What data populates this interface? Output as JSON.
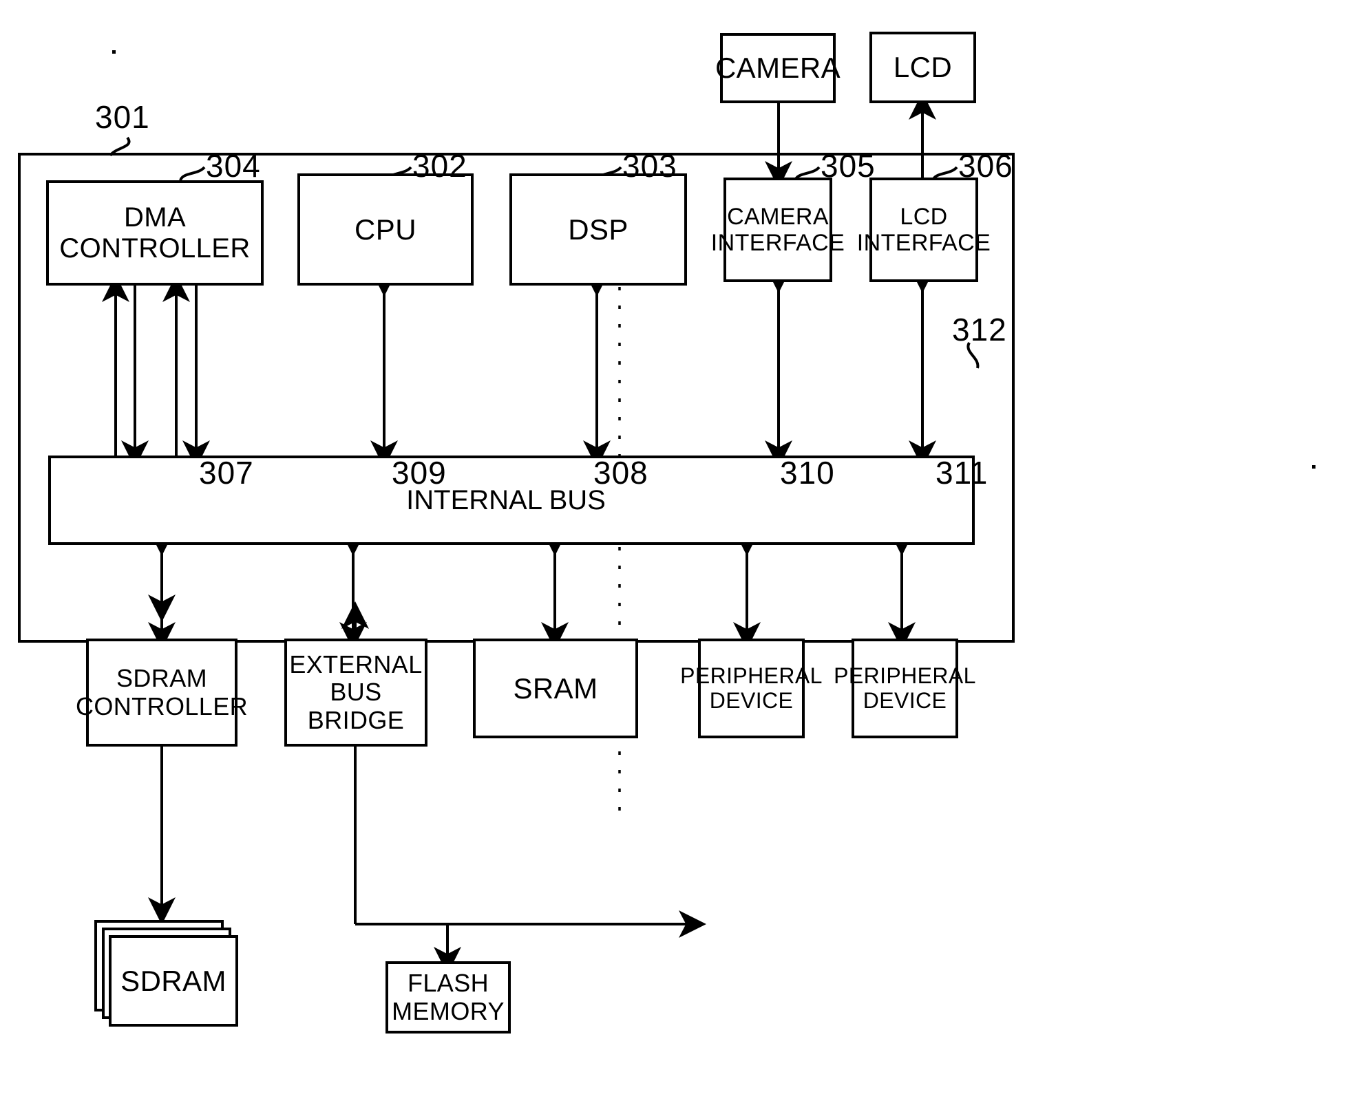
{
  "figure": {
    "type": "block-diagram",
    "title": "System LSI block diagram",
    "chip_label": "301"
  },
  "external_blocks": [
    {
      "id": "camera",
      "label": "CAMERA",
      "ref": ""
    },
    {
      "id": "lcd",
      "label": "LCD",
      "ref": ""
    },
    {
      "id": "sdram",
      "label": "SDRAM",
      "ref": ""
    },
    {
      "id": "flash_memory",
      "label": "FLASH\nMEMORY",
      "ref": ""
    }
  ],
  "internal_blocks": [
    {
      "id": "dma_controller",
      "label": "DMA CONTROLLER",
      "ref": "304"
    },
    {
      "id": "cpu",
      "label": "CPU",
      "ref": "302"
    },
    {
      "id": "dsp",
      "label": "DSP",
      "ref": "303"
    },
    {
      "id": "camera_interface",
      "label": "CAMERA\nINTERFACE",
      "ref": "305"
    },
    {
      "id": "lcd_interface",
      "label": "LCD\nINTERFACE",
      "ref": "306"
    },
    {
      "id": "internal_bus",
      "label": "INTERNAL BUS",
      "ref": "312"
    },
    {
      "id": "sdram_controller",
      "label": "SDRAM\nCONTROLLER",
      "ref": "307"
    },
    {
      "id": "external_bus_bridge",
      "label": "EXTERNAL\nBUS BRIDGE",
      "ref": "309"
    },
    {
      "id": "sram",
      "label": "SRAM",
      "ref": "308"
    },
    {
      "id": "peripheral_device_1",
      "label": "PERIPHERAL\nDEVICE",
      "ref": "310"
    },
    {
      "id": "peripheral_device_2",
      "label": "PERIPHERAL\nDEVICE",
      "ref": "311"
    }
  ],
  "labels": {
    "camera": "CAMERA",
    "lcd": "LCD",
    "dma_controller": "DMA CONTROLLER",
    "cpu": "CPU",
    "dsp": "DSP",
    "camera_interface": "CAMERA\nINTERFACE",
    "lcd_interface": "LCD\nINTERFACE",
    "internal_bus": "INTERNAL BUS",
    "sdram_controller": "SDRAM\nCONTROLLER",
    "external_bus_bridge": "EXTERNAL\nBUS BRIDGE",
    "sram": "SRAM",
    "peripheral_device_1": "PERIPHERAL\nDEVICE",
    "peripheral_device_2": "PERIPHERAL\nDEVICE",
    "sdram": "SDRAM",
    "flash_memory": "FLASH\nMEMORY"
  },
  "refs": {
    "chip": "301",
    "cpu": "302",
    "dsp": "303",
    "dma_controller": "304",
    "camera_interface": "305",
    "lcd_interface": "306",
    "sdram_controller": "307",
    "sram": "308",
    "external_bus_bridge": "309",
    "peripheral_device_1": "310",
    "peripheral_device_2": "311",
    "internal_bus": "312"
  },
  "connections": [
    {
      "from": "camera",
      "to": "camera_interface",
      "direction": "down"
    },
    {
      "from": "lcd_interface",
      "to": "lcd",
      "direction": "up"
    },
    {
      "from": "dma_controller",
      "to": "internal_bus",
      "direction": "four-lines-up-down-up-down"
    },
    {
      "from": "cpu",
      "to": "internal_bus",
      "direction": "bidirectional"
    },
    {
      "from": "dsp",
      "to": "internal_bus",
      "direction": "bidirectional"
    },
    {
      "from": "camera_interface",
      "to": "internal_bus",
      "direction": "bidirectional"
    },
    {
      "from": "lcd_interface",
      "to": "internal_bus",
      "direction": "bidirectional"
    },
    {
      "from": "internal_bus",
      "to": "sdram_controller",
      "direction": "bidirectional"
    },
    {
      "from": "internal_bus",
      "to": "external_bus_bridge",
      "direction": "bidirectional"
    },
    {
      "from": "internal_bus",
      "to": "sram",
      "direction": "bidirectional"
    },
    {
      "from": "internal_bus",
      "to": "peripheral_device_1",
      "direction": "bidirectional"
    },
    {
      "from": "internal_bus",
      "to": "peripheral_device_2",
      "direction": "bidirectional"
    },
    {
      "from": "sdram",
      "to": "sdram_controller",
      "direction": "bidirectional"
    },
    {
      "from": "external_bus_bridge",
      "to": "flash_memory",
      "direction": "down-branch"
    },
    {
      "from": "external_bus_bridge",
      "to": "external",
      "direction": "right-arrow"
    }
  ],
  "colors": {
    "line": "#000000",
    "background": "#ffffff",
    "text": "#000000"
  }
}
